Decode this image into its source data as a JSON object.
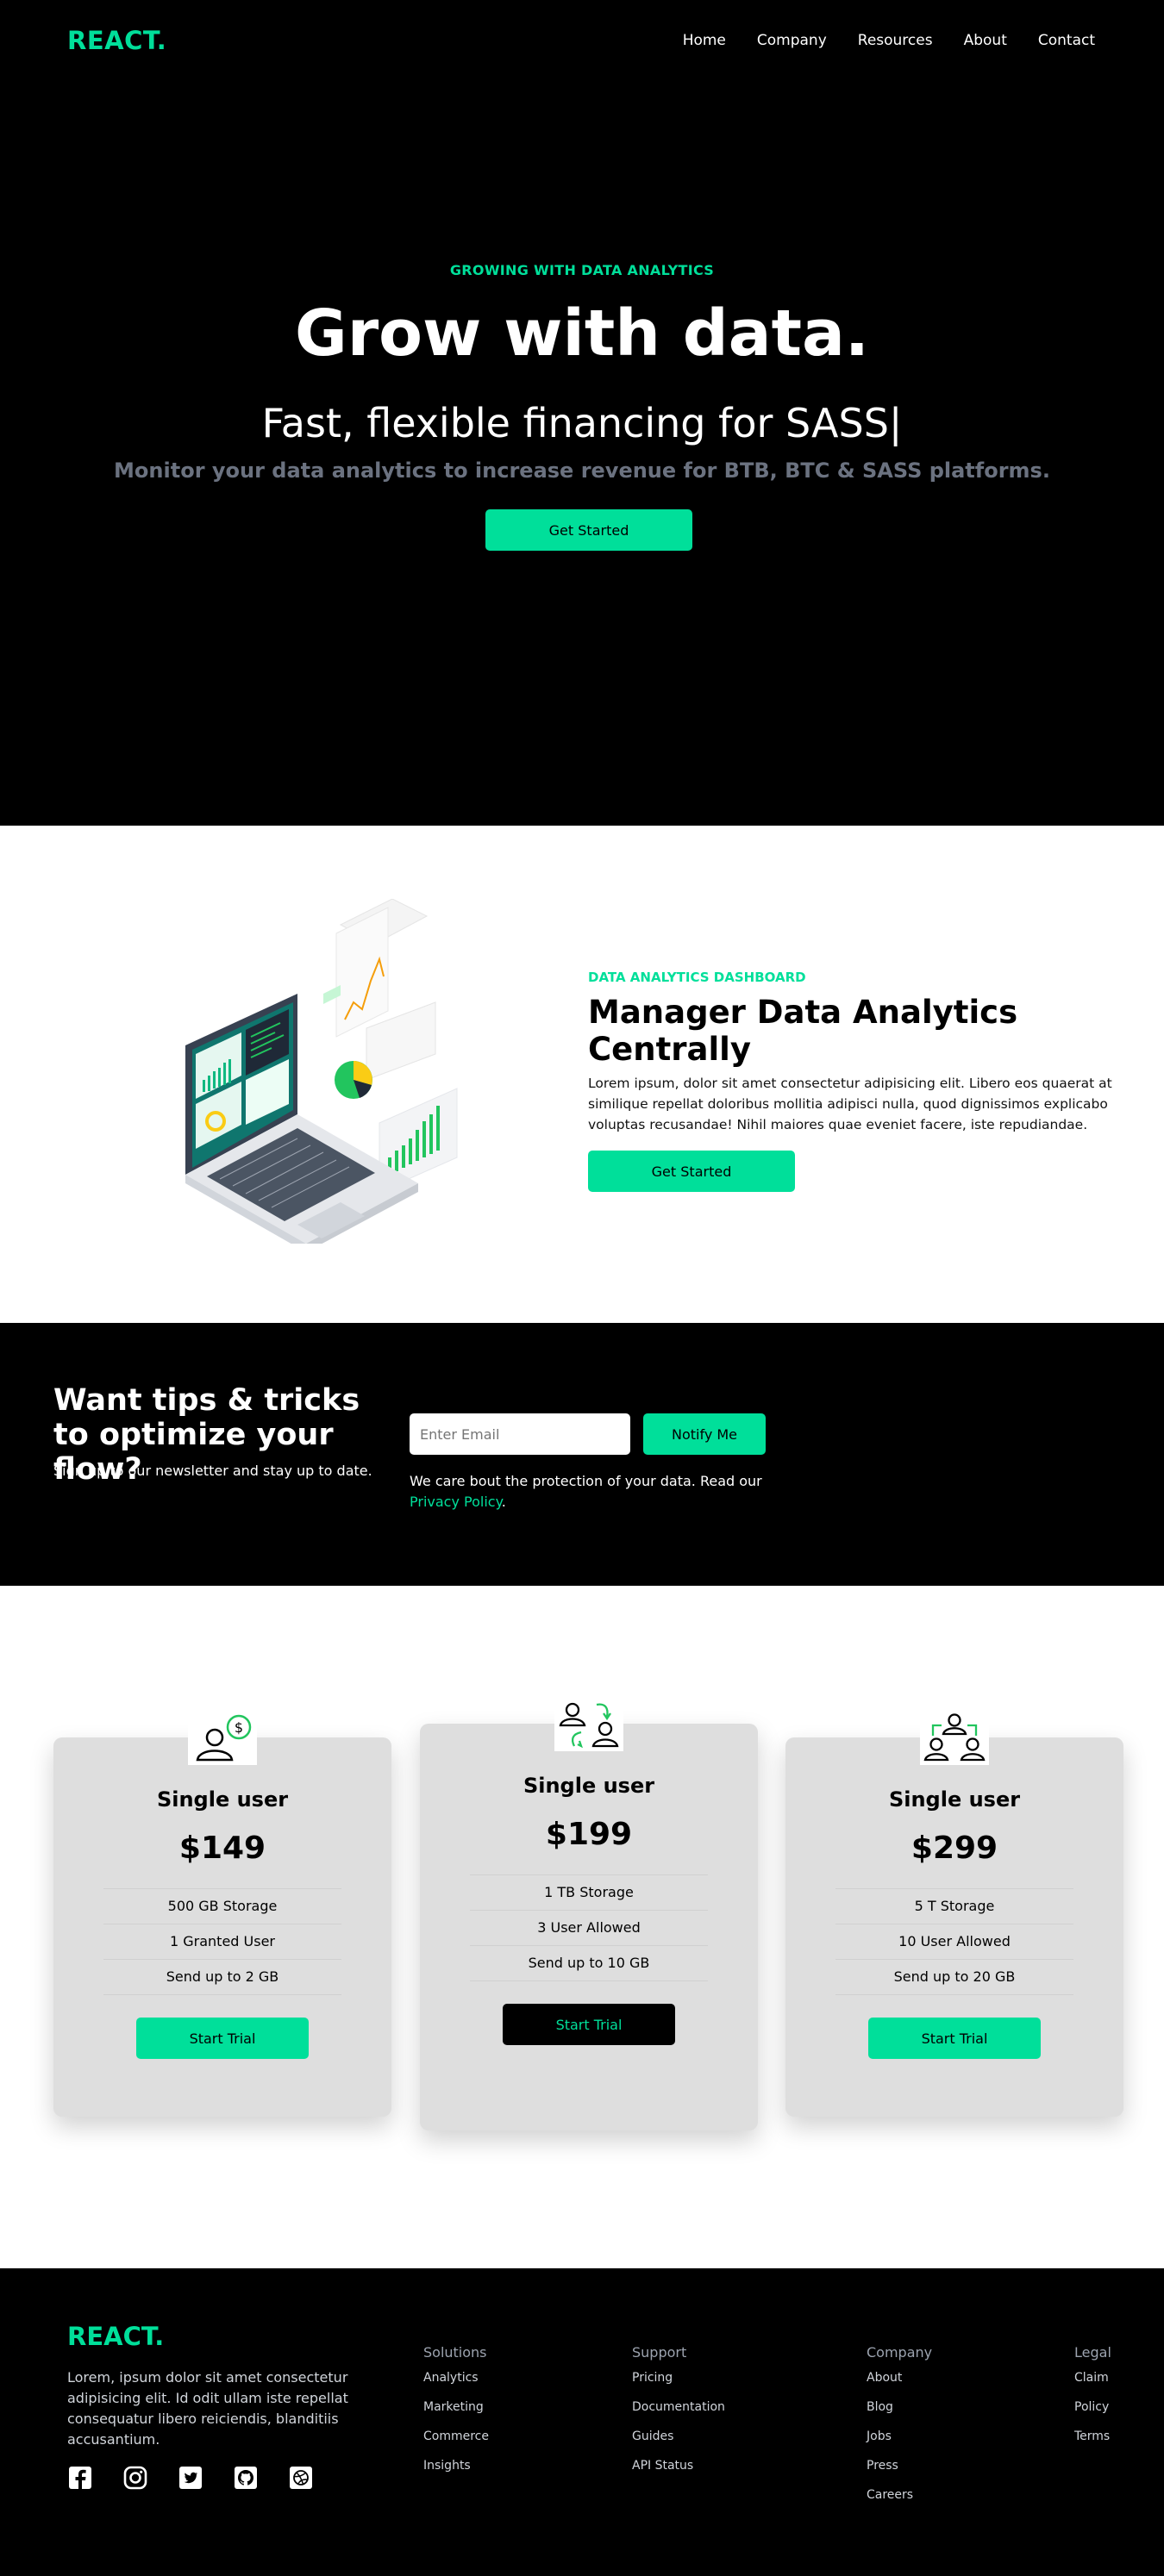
{
  "nav": {
    "logo": "REACT.",
    "links": [
      "Home",
      "Company",
      "Resources",
      "About",
      "Contact"
    ]
  },
  "hero": {
    "eyebrow": "GROWING WITH DATA ANALYTICS",
    "title": "Grow with data.",
    "subtitle": "Fast, flexible financing for SASS",
    "cursor": "|",
    "description": "Monitor your data analytics to increase revenue for BTB, BTC & SASS platforms.",
    "cta": "Get Started"
  },
  "analytics": {
    "eyebrow": "DATA ANALYTICS DASHBOARD",
    "title": "Manager Data Analytics Centrally",
    "body": "Lorem ipsum, dolor sit amet consectetur adipisicing elit. Libero eos quaerat at similique repellat doloribus mollitia adipisci nulla, quod dignissimos explicabo voluptas recusandae! Nihil maiores quae eveniet facere, iste repudiandae.",
    "cta": "Get Started"
  },
  "newsletter": {
    "title": "Want tips & tricks to optimize your flow?",
    "subtitle": "Sign up to our newsletter and stay up to date.",
    "email_placeholder": "Enter Email",
    "button": "Notify Me",
    "note": "We care bout the protection of your data. Read our",
    "privacy_link": "Privacy Policy",
    "note_end": "."
  },
  "pricing": {
    "cards": [
      {
        "name": "Single user",
        "price": "$149",
        "features": [
          "500 GB Storage",
          "1 Granted User",
          "Send up to 2 GB"
        ],
        "button": "Start Trial",
        "icon": "single-user-dollar-icon"
      },
      {
        "name": "Single user",
        "price": "$199",
        "features": [
          "1 TB Storage",
          "3 User Allowed",
          "Send up to 10 GB"
        ],
        "button": "Start Trial",
        "icon": "two-users-exchange-icon"
      },
      {
        "name": "Single user",
        "price": "$299",
        "features": [
          "5 T Storage",
          "10 User Allowed",
          "Send up to 20 GB"
        ],
        "button": "Start Trial",
        "icon": "user-team-icon"
      }
    ]
  },
  "footer": {
    "logo": "REACT.",
    "description": "Lorem, ipsum dolor sit amet consectetur adipisicing elit. Id odit ullam iste repellat consequatur libero reiciendis, blanditiis accusantium.",
    "columns": [
      {
        "title": "Solutions",
        "items": [
          "Analytics",
          "Marketing",
          "Commerce",
          "Insights"
        ]
      },
      {
        "title": "Support",
        "items": [
          "Pricing",
          "Documentation",
          "Guides",
          "API Status"
        ]
      },
      {
        "title": "Company",
        "items": [
          "About",
          "Blog",
          "Jobs",
          "Press",
          "Careers"
        ]
      },
      {
        "title": "Legal",
        "items": [
          "Claim",
          "Policy",
          "Terms"
        ]
      }
    ],
    "socials": [
      "facebook-icon",
      "instagram-icon",
      "twitter-icon",
      "github-icon",
      "dribbble-icon"
    ]
  },
  "colors": {
    "accent": "#00df9a",
    "dark": "#000000",
    "card": "#dedede",
    "muted": "#6b7280"
  }
}
